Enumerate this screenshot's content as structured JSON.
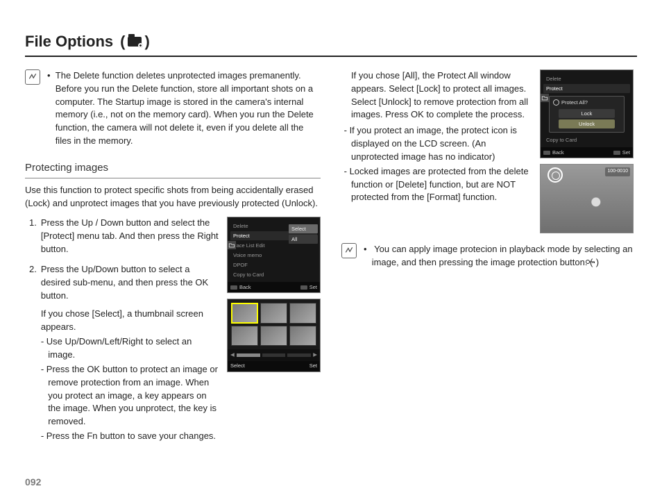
{
  "page": {
    "title": "File Options",
    "number": "092"
  },
  "notes": {
    "delete_note": "The Delete function deletes unprotected images premanently. Before you run the Delete function, store all important shots on a computer. The Startup image is stored in the camera's internal memory (i.e., not on the memory card). When you run the Delete function, the camera will not delete it, even if you delete all the files in the memory.",
    "playback_note": "You can apply image protecion in playback mode by selecting an image, and then pressing the image protection button. ("
  },
  "section": {
    "heading": "Protecting images",
    "intro": "Use this function to protect specific shots from being accidentally erased (Lock) and unprotect images that you have previously protected (Unlock)."
  },
  "steps": {
    "s1_num": "1.",
    "s1": "Press the Up / Down button and select the [Protect] menu tab. And then press the Right button.",
    "s2_num": "2.",
    "s2": "Press the Up/Down button to select a desired sub-menu, and then press the OK button.",
    "s2_a": "If you chose [Select], a thumbnail screen appears.",
    "s2_b": "Use Up/Down/Left/Right to select an image.",
    "s2_c": "Press the OK button to protect an image or remove protection from an image. When you protect an image, a key appears on the image. When you unprotect, the key is removed.",
    "s2_d": "Press the Fn button to save your changes."
  },
  "rightcol": {
    "all_intro": "If you chose [All], the Protect All window appears. Select [Lock] to protect all images. Select [Unlock] to remove protection from all images. Press OK to complete the process.",
    "r1": "If you protect an image, the protect icon is displayed on the LCD screen. (An unprotected image has no indicator)",
    "r2": "Locked images are protected from the delete function or [Delete] function, but are NOT protected from the [Format] function."
  },
  "lcd1": {
    "items": [
      "Delete",
      "Protect",
      "Face List Edit",
      "Voice memo",
      "DPOF",
      "Copy to Card"
    ],
    "side": [
      "Select",
      "All"
    ],
    "footer_left": "Back",
    "footer_right": "Set"
  },
  "thumbs": {
    "footer_left": "Select",
    "footer_right": "Set",
    "pages": [
      "1",
      "2",
      "3"
    ]
  },
  "lcd2": {
    "items": [
      "Delete",
      "Protect",
      "",
      "",
      "",
      "Copy to Card"
    ],
    "dialog_title": "Protect All?",
    "btn_lock": "Lock",
    "btn_unlock": "Unlock",
    "footer_left": "Back",
    "footer_right": "Set"
  },
  "photo": {
    "tag": "100-0010"
  }
}
